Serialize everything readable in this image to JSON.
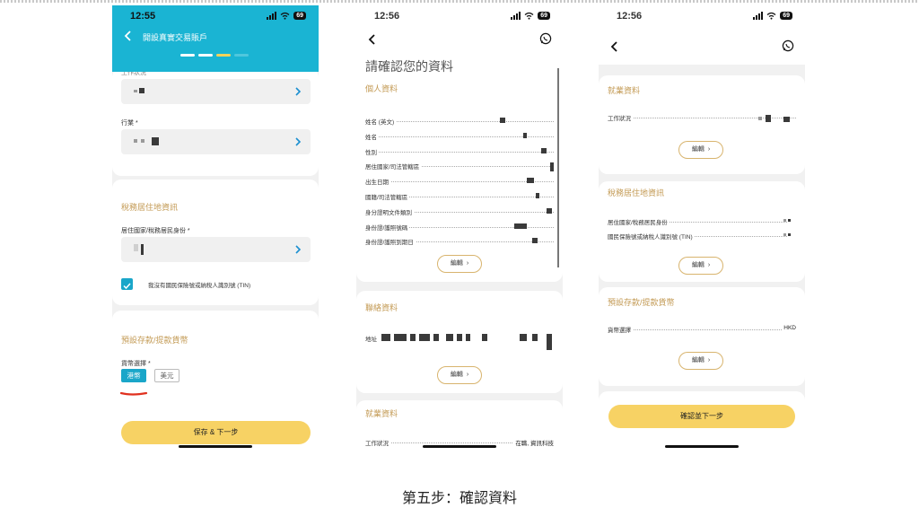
{
  "caption": "第五步：確認資料",
  "phone1": {
    "status_time": "12:55",
    "battery": "69",
    "header_title": "開設真實交易賬戶",
    "colors": {
      "header": "#1ab4d3",
      "progress_active": "#f3d35a",
      "accent_blue": "#1aa6c9",
      "underline_red": "#e0311f"
    },
    "field_occupation_label": "工作狀況",
    "field_industry_label": "行業 *",
    "tax_section_title": "稅務居住地資訊",
    "residence_label": "居住國家/稅務居民身份 *",
    "tin_checkbox_label": "我沒有國民保險號或納稅人識別號 (TIN)",
    "tin_checked": true,
    "currency_section_title": "預設存款/提款貨幣",
    "currency_label": "貨幣選擇 *",
    "currency_options": [
      "港幣",
      "美元"
    ],
    "currency_selected": "港幣",
    "save_next_button": "保存 & 下一步"
  },
  "phone2": {
    "status_time": "12:56",
    "battery": "69",
    "page_title": "請確認您的資料",
    "personal_section_title": "個人資料",
    "personal_rows": [
      "姓名 (英文)",
      "姓名",
      "性別",
      "居住國家/司法管轄區",
      "出生日期",
      "國籍/司法管轄區",
      "身分證明文件類別",
      "身份證/護照號碼",
      "身份證/護照到期日"
    ],
    "edit_label": "編輯",
    "contact_section_title": "聯絡資料",
    "address_label": "地址",
    "employment_section_title": "就業資料",
    "employment_status_label": "工作狀況",
    "employment_status_value": "在職, 資訊科技"
  },
  "phone3": {
    "status_time": "12:56",
    "battery": "69",
    "employment_section_title": "就業資料",
    "employment_status_label": "工作狀況",
    "edit_label": "編輯",
    "tax_section_title": "稅務居住地資訊",
    "tax_rows": [
      "居住國家/稅務居民身份",
      "國民保險號或納稅人識別號 (TIN)"
    ],
    "currency_section_title": "預設存款/提款貨幣",
    "currency_label": "貨幣選擇",
    "currency_value": "HKD",
    "confirm_next_button": "確認並下一步"
  }
}
